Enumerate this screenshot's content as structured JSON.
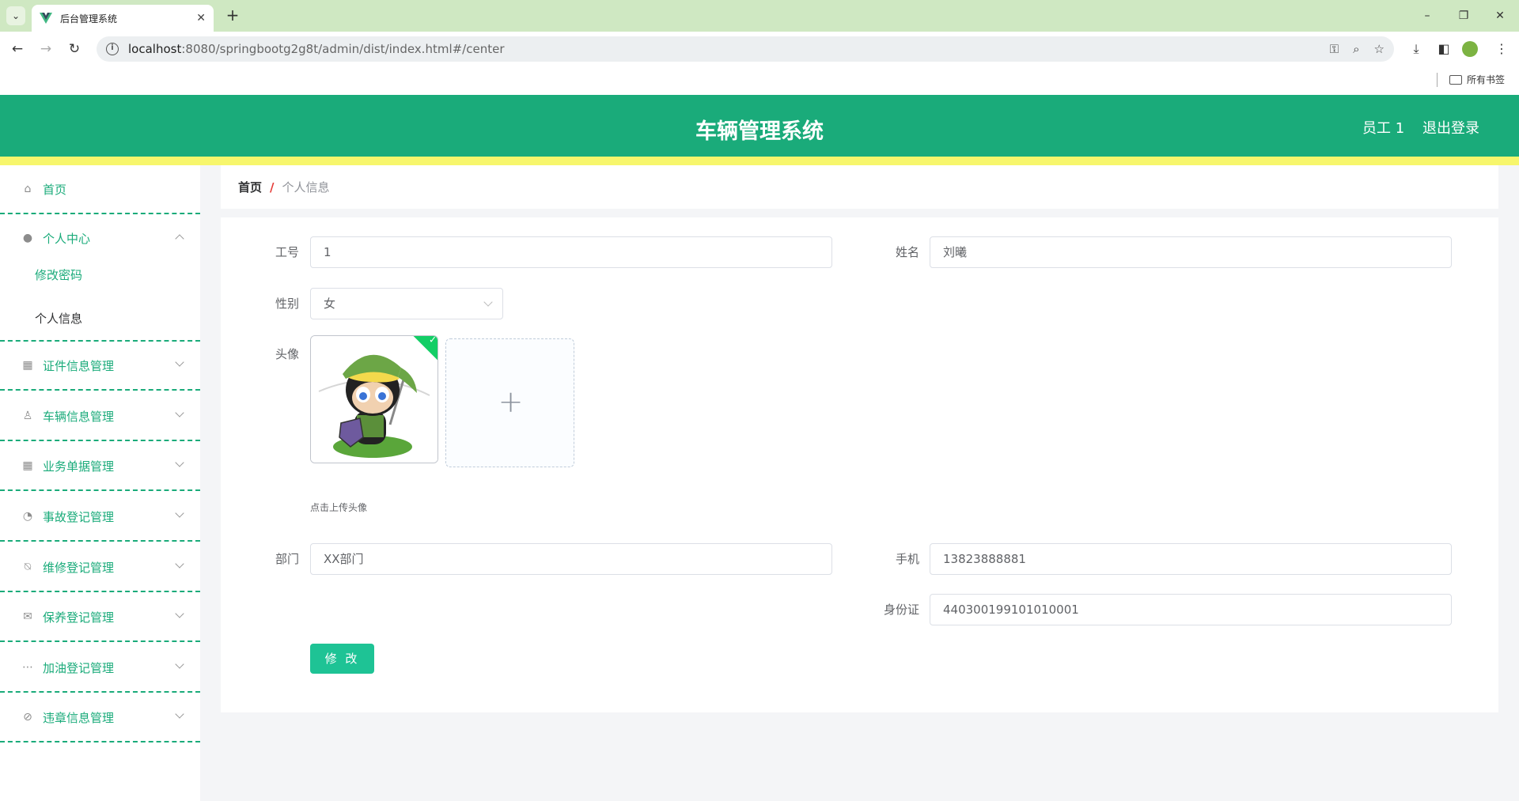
{
  "browser": {
    "tab_title": "后台管理系统",
    "url_host": "localhost",
    "url_rest": ":8080/springbootg2g8t/admin/dist/index.html#/center",
    "bookmarks_label": "所有书签"
  },
  "header": {
    "title": "车辆管理系统",
    "user": "员工 1",
    "logout": "退出登录"
  },
  "sidebar": {
    "home": "首页",
    "personal_center": "个人中心",
    "change_password": "修改密码",
    "personal_info": "个人信息",
    "items": [
      {
        "label": "证件信息管理",
        "icon": "grid-icon"
      },
      {
        "label": "车辆信息管理",
        "icon": "user-stamp-icon"
      },
      {
        "label": "业务单据管理",
        "icon": "apps-icon"
      },
      {
        "label": "事故登记管理",
        "icon": "gauge-icon"
      },
      {
        "label": "维修登记管理",
        "icon": "microphone-icon"
      },
      {
        "label": "保养登记管理",
        "icon": "mail-icon"
      },
      {
        "label": "加油登记管理",
        "icon": "chat-icon"
      },
      {
        "label": "违章信息管理",
        "icon": "compass-icon"
      }
    ]
  },
  "breadcrumb": {
    "home": "首页",
    "separator": "/",
    "current": "个人信息"
  },
  "form": {
    "employee_no_label": "工号",
    "employee_no": "1",
    "name_label": "姓名",
    "name": "刘曦",
    "gender_label": "性别",
    "gender": "女",
    "avatar_label": "头像",
    "upload_tip": "点击上传头像",
    "department_label": "部门",
    "department": "XX部门",
    "phone_label": "手机",
    "phone": "13823888881",
    "id_card_label": "身份证",
    "id_card": "440300199101010001",
    "submit": "修 改"
  },
  "colors": {
    "primary": "#1aab7a",
    "accent_band": "#f7f66c",
    "button": "#1ec395"
  }
}
